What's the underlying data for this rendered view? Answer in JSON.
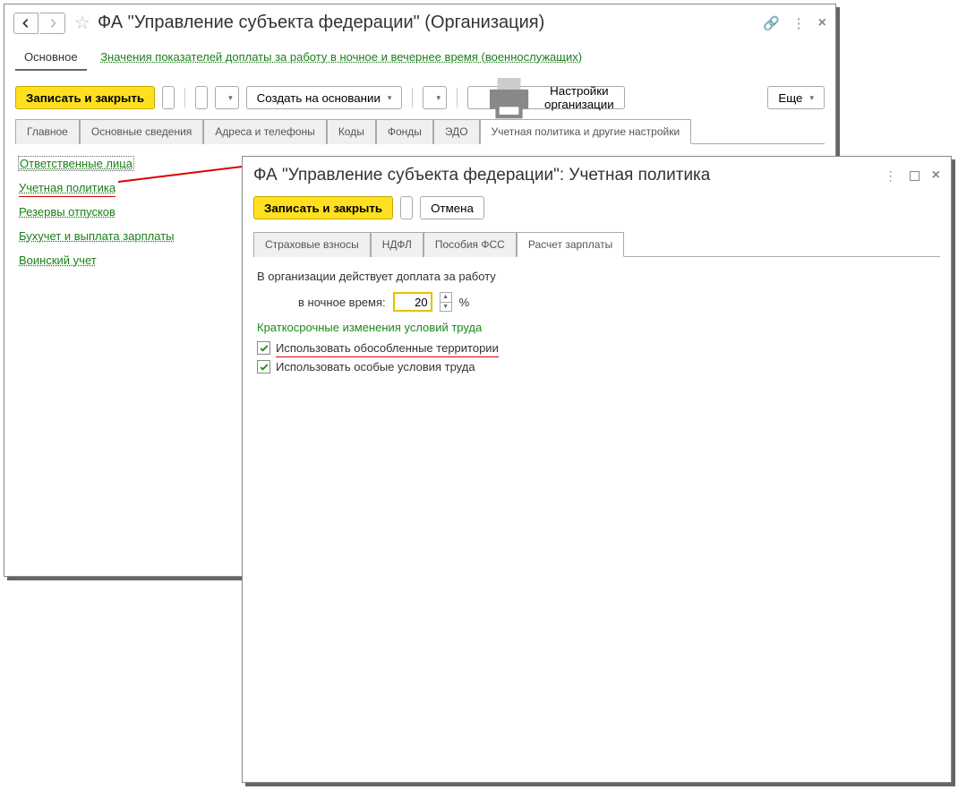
{
  "win1": {
    "title": "ФА \"Управление субъекта федерации\" (Организация)",
    "sublink_main": "Основное",
    "sublink": "Значения показателей доплаты за работу в ночное и вечернее время (военнослужащих)",
    "toolbar": {
      "save_close": "Записать и закрыть",
      "create_based": "Создать на основании",
      "settings_org": "Настройки организации",
      "more": "Еще"
    },
    "tabs": [
      "Главное",
      "Основные сведения",
      "Адреса и телефоны",
      "Коды",
      "Фонды",
      "ЭДО",
      "Учетная политика и другие настройки"
    ],
    "links": [
      "Ответственные лица",
      "Учетная политика",
      "Резервы отпусков",
      "Бухучет и выплата зарплаты",
      "Воинский учет"
    ]
  },
  "win2": {
    "title": "ФА \"Управление субъекта федерации\": Учетная политика",
    "toolbar": {
      "save_close": "Записать и закрыть",
      "cancel": "Отмена"
    },
    "tabs": [
      "Страховые взносы",
      "НДФЛ",
      "Пособия ФСС",
      "Расчет зарплаты"
    ],
    "content": {
      "line1": "В организации действует доплата за работу",
      "night_label": "в ночное время:",
      "night_value": "20",
      "percent": "%",
      "section": "Краткосрочные изменения условий труда",
      "chk1": "Использовать обособленные территории",
      "chk2": "Использовать особые условия труда"
    }
  }
}
